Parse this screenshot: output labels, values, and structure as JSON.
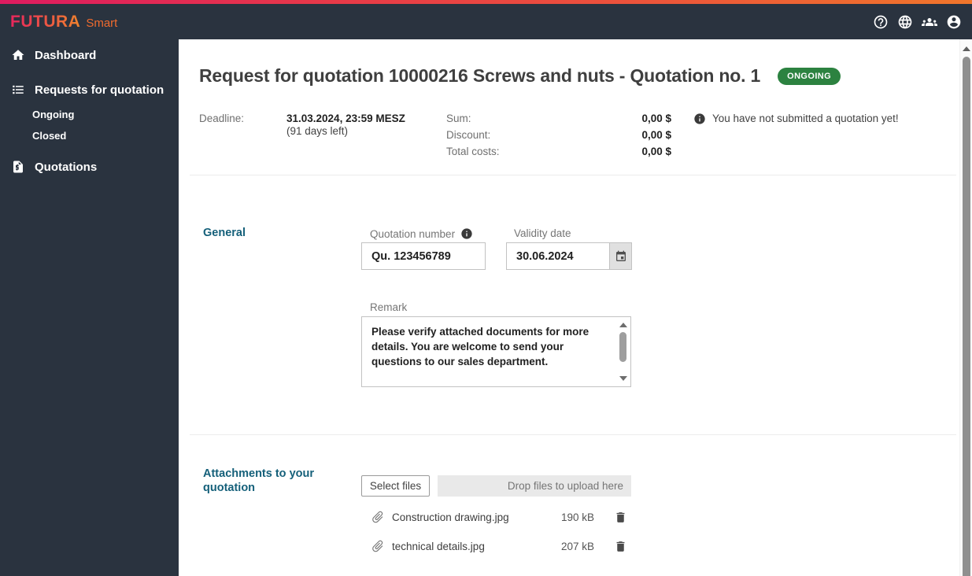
{
  "brand": {
    "logo": "FUTURA",
    "logo_suffix": "Smart"
  },
  "colors": {
    "top_strip_left": "#de1b60",
    "top_strip_right": "#f0762b",
    "dark_chrome": "#2a333f",
    "section_heading": "#15607a",
    "status_badge_green": "#2c8240",
    "logo_gradient_start": "#e8255d",
    "logo_gradient_end": "#f0832d"
  },
  "header": {
    "icons": [
      "help-icon",
      "language-globe-icon",
      "users-group-icon",
      "account-icon"
    ]
  },
  "sidebar": {
    "items": [
      {
        "label": "Dashboard",
        "icon": "home-icon"
      },
      {
        "label": "Requests for quotation",
        "icon": "list-icon",
        "children": [
          "Ongoing",
          "Closed"
        ]
      },
      {
        "label": "Quotations",
        "icon": "quote-document-icon"
      }
    ]
  },
  "page": {
    "title": "Request for quotation 10000216 Screws and nuts - Quotation no. 1",
    "status_badge": "ONGOING",
    "summary": {
      "deadline_label": "Deadline:",
      "deadline_value": "31.03.2024, 23:59 MESZ",
      "deadline_note": "(91 days left)",
      "totals": [
        {
          "label": "Sum:",
          "value": "0,00 $"
        },
        {
          "label": "Discount:",
          "value": "0,00 $"
        },
        {
          "label": "Total costs:",
          "value": "0,00 $"
        }
      ],
      "info_message": "You have not submitted a quotation yet!"
    },
    "general": {
      "section_label": "General",
      "quotation_number_label": "Quotation number",
      "quotation_number_value": "Qu. 123456789",
      "validity_date_label": "Validity date",
      "validity_date_value": "30.06.2024",
      "remark_label": "Remark",
      "remark_value": "Please verify attached documents for more details. You are welcome to send your questions to our sales department."
    },
    "attachments": {
      "section_label": "Attachments to your quotation",
      "select_files_label": "Select files",
      "dropzone_label": "Drop files to upload here",
      "files": [
        {
          "name": "Construction drawing.jpg",
          "size": "190 kB"
        },
        {
          "name": "technical details.jpg",
          "size": "207 kB"
        }
      ]
    }
  }
}
